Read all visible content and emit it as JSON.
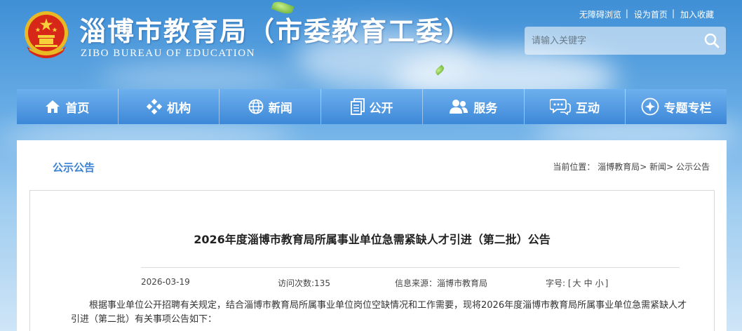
{
  "header": {
    "title": "淄博市教育局（市委教育工委）",
    "subtitle": "ZIBO BUREAU OF EDUCATION",
    "top_links": [
      "无障碍浏览",
      "设为首页",
      "加入收藏"
    ],
    "search_placeholder": "请输入关键字"
  },
  "nav": {
    "items": [
      {
        "label": "首页",
        "icon": "home-icon"
      },
      {
        "label": "机构",
        "icon": "org-icon"
      },
      {
        "label": "新闻",
        "icon": "globe-icon"
      },
      {
        "label": "公开",
        "icon": "document-icon"
      },
      {
        "label": "服务",
        "icon": "users-icon"
      },
      {
        "label": "互动",
        "icon": "chat-icon"
      },
      {
        "label": "专题专栏",
        "icon": "plus-circle-icon"
      }
    ]
  },
  "panel": {
    "title": "公示公告",
    "breadcrumb": {
      "prefix": "当前位置：",
      "items": [
        "淄博教育局",
        "新闻",
        "公示公告"
      ],
      "separator": ">"
    }
  },
  "article": {
    "title": "2026年度淄博市教育局所属事业单位急需紧缺人才引进（第二批）公告",
    "date": "2026-03-19",
    "views_label": "访问次数:135",
    "source_label": "信息来源：淄博市教育局",
    "font_size_label": "字号:",
    "font_sizes": [
      "大",
      "中",
      "小"
    ],
    "body": "根据事业单位公开招聘有关规定，结合淄博市教育局所属事业单位岗位空缺情况和工作需要，现将2026年度淄博市教育局所属事业单位急需紧缺人才引进（第二批）有关事项公告如下："
  },
  "colors": {
    "accent": "#3b82d4",
    "nav_top": "#6eb0ee",
    "nav_bottom": "#3d88d8"
  }
}
